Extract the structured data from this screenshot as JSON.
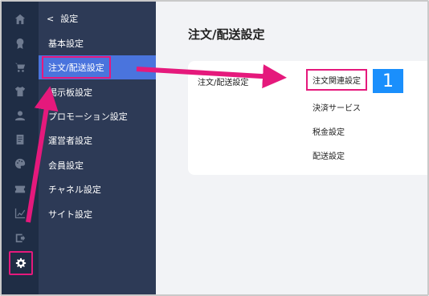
{
  "rail": {
    "icons": [
      "home-icon",
      "badge-icon",
      "cart-icon",
      "tshirt-icon",
      "user-icon",
      "document-icon",
      "palette-icon",
      "ticket-icon",
      "analytics-icon",
      "export-icon",
      "gear-icon"
    ]
  },
  "submenu": {
    "back_label": "設定",
    "items": [
      {
        "label": "基本設定"
      },
      {
        "label": "注文/配送設定"
      },
      {
        "label": "掲示板設定"
      },
      {
        "label": "プロモーション設定"
      },
      {
        "label": "運営者設定"
      },
      {
        "label": "会員設定"
      },
      {
        "label": "チャネル設定"
      },
      {
        "label": "サイト設定"
      }
    ]
  },
  "main": {
    "title": "注文/配送設定",
    "section_label": "注文/配送設定",
    "links": [
      {
        "label": "注文関連設定"
      },
      {
        "label": "決済サービス"
      },
      {
        "label": "税金設定"
      },
      {
        "label": "配送設定"
      }
    ],
    "step_badge": "1"
  },
  "colors": {
    "rail_bg": "#1f2d45",
    "submenu_bg": "#2d3a56",
    "active_item": "#4a74dd",
    "highlight": "#e5197c",
    "badge": "#1a8ffc"
  }
}
